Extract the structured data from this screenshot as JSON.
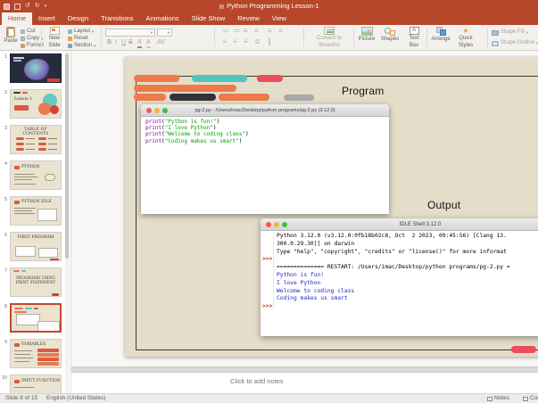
{
  "window": {
    "title": "Python Programming Lesson-1"
  },
  "tabs": [
    {
      "label": "Home",
      "active": true
    },
    {
      "label": "Insert"
    },
    {
      "label": "Design"
    },
    {
      "label": "Transitions"
    },
    {
      "label": "Animations"
    },
    {
      "label": "Slide Show"
    },
    {
      "label": "Review"
    },
    {
      "label": "View"
    }
  ],
  "ribbon": {
    "paste": "Paste",
    "cut": "Cut",
    "copy": "Copy",
    "format": "Format",
    "new_slide_1": "New",
    "new_slide_2": "Slide",
    "layout": "Layout",
    "reset": "Reset",
    "section": "Section",
    "convert_1": "Convert to",
    "convert_2": "SmartArt",
    "picture": "Picture",
    "shapes": "Shapes",
    "text_box_1": "Text",
    "text_box_2": "Box",
    "arrange": "Arrange",
    "quick_styles_1": "Quick",
    "quick_styles_2": "Styles",
    "shape_fill": "Shape Fill",
    "shape_outline": "Shape Outline"
  },
  "sidebar": {
    "slides": [
      {
        "num": 1,
        "variant": "cover",
        "title": ""
      },
      {
        "num": 2,
        "variant": "lesson",
        "title": "Lesson 1"
      },
      {
        "num": 3,
        "variant": "toc",
        "title": "TABLE OF CONTENTS"
      },
      {
        "num": 4,
        "variant": "python",
        "title": "PYTHON"
      },
      {
        "num": 5,
        "variant": "idle",
        "title": "PYTHON IDLE"
      },
      {
        "num": 6,
        "variant": "first",
        "title": "FIRST PROGRAM"
      },
      {
        "num": 7,
        "variant": "programs",
        "title": "PROGRAMS USING PRINT STATEMENT"
      },
      {
        "num": 8,
        "variant": "current",
        "title": "",
        "selected": true
      },
      {
        "num": 9,
        "variant": "variables",
        "title": "VARIABLES"
      },
      {
        "num": 10,
        "variant": "input",
        "title": "INPUT FUNCTION"
      }
    ]
  },
  "slide": {
    "program_label": "Program",
    "output_label": "Output",
    "editor": {
      "title": "pg-2.py - /Users/imac/Desktop/python programs/pg-2.py (3.12.0)",
      "code": [
        [
          {
            "t": "print",
            "c": "kw"
          },
          {
            "t": "(",
            "c": "pl"
          },
          {
            "t": "\"Python is fun!\"",
            "c": "str"
          },
          {
            "t": ")",
            "c": "pl"
          }
        ],
        [
          {
            "t": "print",
            "c": "kw"
          },
          {
            "t": "(",
            "c": "pl"
          },
          {
            "t": "\"I love Python\"",
            "c": "str"
          },
          {
            "t": ")",
            "c": "pl"
          }
        ],
        [
          {
            "t": "print",
            "c": "kw"
          },
          {
            "t": "(",
            "c": "pl"
          },
          {
            "t": "\"Welcome to coding class\"",
            "c": "str"
          },
          {
            "t": ")",
            "c": "pl"
          }
        ],
        [
          {
            "t": "print",
            "c": "kw"
          },
          {
            "t": "(",
            "c": "pl"
          },
          {
            "t": "\"Coding makes us smart\"",
            "c": "str"
          },
          {
            "t": ")",
            "c": "pl"
          }
        ]
      ]
    },
    "shell": {
      "title": "IDLE Shell 3.12.0",
      "lines": [
        {
          "gutter": "",
          "style": "plain",
          "text": "Python 3.12.0 (v3.12.0:0fb18b02c8, Oct  2 2023, 09:45:56) [Clang 13."
        },
        {
          "gutter": "",
          "style": "plain",
          "text": "300.0.29.30]] on darwin"
        },
        {
          "gutter": "",
          "style": "plain",
          "text": "Type \"help\", \"copyright\", \"credits\" or \"license()\" for more informat"
        },
        {
          "gutter": ">>>",
          "style": "plain",
          "text": ""
        },
        {
          "gutter": "",
          "style": "plain",
          "text": "============== RESTART: /Users/imac/Desktop/python programs/pg-2.py ="
        },
        {
          "gutter": "",
          "style": "out",
          "text": "Python is fun!"
        },
        {
          "gutter": "",
          "style": "out",
          "text": "I love Python"
        },
        {
          "gutter": "",
          "style": "out",
          "text": "Welcome to coding class"
        },
        {
          "gutter": "",
          "style": "out",
          "text": "Coding makes us smart"
        },
        {
          "gutter": ">>>",
          "style": "plain",
          "text": ""
        }
      ]
    }
  },
  "notes": {
    "placeholder": "Click to add notes"
  },
  "statusbar": {
    "slide_info": "Slide 8 of 15",
    "language": "English (United States)",
    "notes": "Notes",
    "comments": "Comments"
  },
  "colors": {
    "accent": "#b7472a",
    "slide_bg": "#e3ddc9",
    "pill_orange": "#ed7a48",
    "pill_teal": "#56c4bd",
    "pill_pink": "#ee4b5e",
    "pill_dark": "#33323a",
    "pill_gray": "#a8a8a8",
    "code_keyword": "#8000a0",
    "code_string": "#00a000",
    "shell_output": "#1f1fd1",
    "shell_prompt": "#bf3226"
  }
}
